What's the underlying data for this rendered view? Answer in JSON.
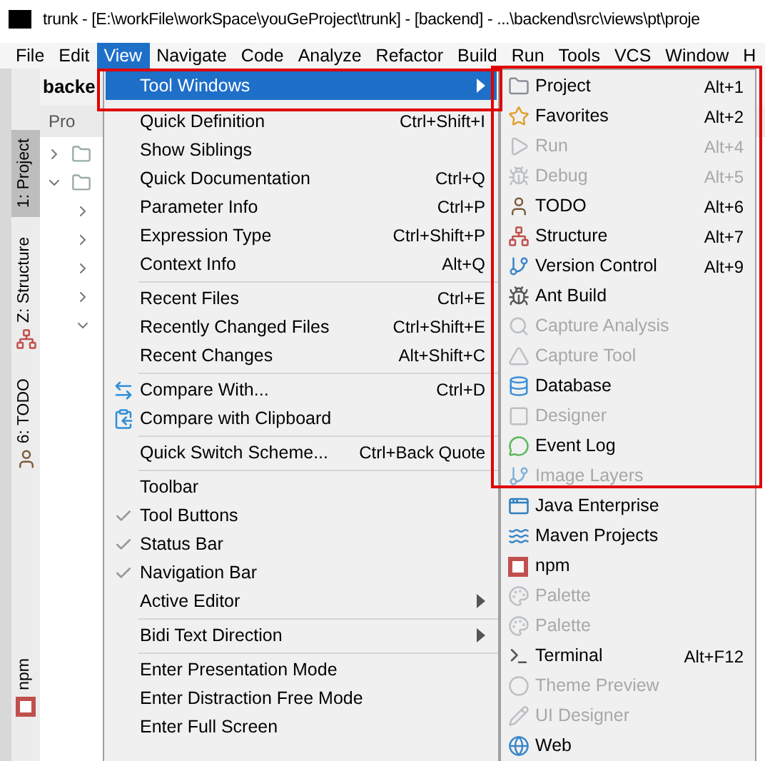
{
  "window": {
    "title": "trunk - [E:\\workFile\\workSpace\\youGeProject\\trunk] - [backend] - ...\\backend\\src\\views\\pt\\proje"
  },
  "menu_bar": [
    {
      "label": "File",
      "selected": false
    },
    {
      "label": "Edit",
      "selected": false
    },
    {
      "label": "View",
      "selected": true
    },
    {
      "label": "Navigate",
      "selected": false
    },
    {
      "label": "Code",
      "selected": false
    },
    {
      "label": "Analyze",
      "selected": false
    },
    {
      "label": "Refactor",
      "selected": false
    },
    {
      "label": "Build",
      "selected": false
    },
    {
      "label": "Run",
      "selected": false
    },
    {
      "label": "Tools",
      "selected": false
    },
    {
      "label": "VCS",
      "selected": false
    },
    {
      "label": "Window",
      "selected": false
    },
    {
      "label": "H",
      "selected": false
    }
  ],
  "navigation_bar": {
    "label": "backe"
  },
  "side_tabs": [
    {
      "label": "1: Project",
      "selected": true,
      "kind": "plain"
    },
    {
      "label": "Z: Structure",
      "selected": false,
      "kind": "structure"
    },
    {
      "label": "6: TODO",
      "selected": false,
      "kind": "todo"
    },
    {
      "label": "npm",
      "selected": false,
      "kind": "npm"
    }
  ],
  "project_panel": {
    "tab": "Pro",
    "tree": [
      {
        "expanded": false
      },
      {
        "expanded": true,
        "children": [
          {
            "expanded": false
          },
          {
            "expanded": false
          },
          {
            "expanded": false
          },
          {
            "expanded": false
          },
          {
            "expanded": true
          }
        ]
      }
    ]
  },
  "view_menu": [
    {
      "kind": "item",
      "label": "Tool Windows",
      "submenu": true,
      "selected": true,
      "checked": false
    },
    {
      "kind": "gap"
    },
    {
      "kind": "item",
      "label": "Quick Definition",
      "shortcut": "Ctrl+Shift+I",
      "submenu": false,
      "selected": false,
      "checked": false
    },
    {
      "kind": "item",
      "label": "Show Siblings",
      "submenu": false,
      "selected": false,
      "checked": false
    },
    {
      "kind": "item",
      "label": "Quick Documentation",
      "shortcut": "Ctrl+Q",
      "submenu": false,
      "selected": false,
      "checked": false
    },
    {
      "kind": "item",
      "label": "Parameter Info",
      "shortcut": "Ctrl+P",
      "submenu": false,
      "selected": false,
      "checked": false
    },
    {
      "kind": "item",
      "label": "Expression Type",
      "shortcut": "Ctrl+Shift+P",
      "submenu": false,
      "selected": false,
      "checked": false
    },
    {
      "kind": "item",
      "label": "Context Info",
      "shortcut": "Alt+Q",
      "submenu": false,
      "selected": false,
      "checked": false
    },
    {
      "kind": "separator"
    },
    {
      "kind": "item",
      "label": "Recent Files",
      "shortcut": "Ctrl+E",
      "submenu": false,
      "selected": false,
      "checked": false
    },
    {
      "kind": "item",
      "label": "Recently Changed Files",
      "shortcut": "Ctrl+Shift+E",
      "submenu": false,
      "selected": false,
      "checked": false
    },
    {
      "kind": "item",
      "label": "Recent Changes",
      "shortcut": "Alt+Shift+C",
      "submenu": false,
      "selected": false,
      "checked": false
    },
    {
      "kind": "separator"
    },
    {
      "kind": "compare",
      "label": "Compare With...",
      "shortcut": "Ctrl+D",
      "submenu": false,
      "selected": false,
      "checked": false
    },
    {
      "kind": "clipboard",
      "label": "Compare with Clipboard",
      "submenu": false,
      "selected": false,
      "checked": false
    },
    {
      "kind": "separator"
    },
    {
      "kind": "item",
      "label": "Quick Switch Scheme...",
      "shortcut": "Ctrl+Back Quote",
      "submenu": false,
      "selected": false,
      "checked": false
    },
    {
      "kind": "separator"
    },
    {
      "kind": "item",
      "label": "Toolbar",
      "submenu": false,
      "selected": false,
      "checked": false
    },
    {
      "kind": "item",
      "label": "Tool Buttons",
      "submenu": false,
      "selected": false,
      "checked": true
    },
    {
      "kind": "item",
      "label": "Status Bar",
      "submenu": false,
      "selected": false,
      "checked": true
    },
    {
      "kind": "item",
      "label": "Navigation Bar",
      "submenu": false,
      "selected": false,
      "checked": true
    },
    {
      "kind": "item",
      "label": "Active Editor",
      "submenu": true,
      "selected": false,
      "checked": false
    },
    {
      "kind": "separator"
    },
    {
      "kind": "item",
      "label": "Bidi Text Direction",
      "submenu": true,
      "selected": false,
      "checked": false
    },
    {
      "kind": "separator"
    },
    {
      "kind": "item",
      "label": "Enter Presentation Mode",
      "submenu": false,
      "selected": false,
      "checked": false
    },
    {
      "kind": "item",
      "label": "Enter Distraction Free Mode",
      "submenu": false,
      "selected": false,
      "checked": false
    },
    {
      "kind": "item",
      "label": "Enter Full Screen",
      "submenu": false,
      "selected": false,
      "checked": false
    }
  ],
  "tool_windows_menu": [
    {
      "label": "Project",
      "shortcut": "Alt+1",
      "disabled": false,
      "kind": "folder"
    },
    {
      "label": "Favorites",
      "shortcut": "Alt+2",
      "disabled": false,
      "kind": "star"
    },
    {
      "label": "Run",
      "shortcut": "Alt+4",
      "disabled": true,
      "kind": "play"
    },
    {
      "label": "Debug",
      "shortcut": "Alt+5",
      "disabled": true,
      "kind": "bug"
    },
    {
      "label": "TODO",
      "shortcut": "Alt+6",
      "disabled": false,
      "kind": "todo"
    },
    {
      "label": "Structure",
      "shortcut": "Alt+7",
      "disabled": false,
      "kind": "structure"
    },
    {
      "label": "Version Control",
      "shortcut": "Alt+9",
      "disabled": false,
      "kind": "branch"
    },
    {
      "label": "Ant Build",
      "disabled": false,
      "kind": "ant"
    },
    {
      "label": "Capture Analysis",
      "disabled": true,
      "kind": "search"
    },
    {
      "label": "Capture Tool",
      "disabled": true,
      "kind": "triangle"
    },
    {
      "label": "Database",
      "disabled": false,
      "kind": "database"
    },
    {
      "label": "Designer",
      "disabled": true,
      "kind": "square"
    },
    {
      "label": "Event Log",
      "disabled": false,
      "kind": "bubble"
    },
    {
      "label": "Image Layers",
      "disabled": true,
      "kind": "branch"
    },
    {
      "label": "Java Enterprise",
      "disabled": false,
      "kind": "window"
    },
    {
      "label": "Maven Projects",
      "disabled": false,
      "kind": "curve"
    },
    {
      "label": "npm",
      "disabled": false,
      "kind": "npm"
    },
    {
      "label": "Palette",
      "disabled": true,
      "kind": "palette"
    },
    {
      "label": "Palette",
      "disabled": true,
      "kind": "palette"
    },
    {
      "label": "Terminal",
      "shortcut": "Alt+F12",
      "disabled": false,
      "kind": "terminal"
    },
    {
      "label": "Theme Preview",
      "disabled": true,
      "kind": "circle"
    },
    {
      "label": "UI Designer",
      "disabled": true,
      "kind": "pencil"
    },
    {
      "label": "Web",
      "disabled": false,
      "kind": "web"
    }
  ]
}
